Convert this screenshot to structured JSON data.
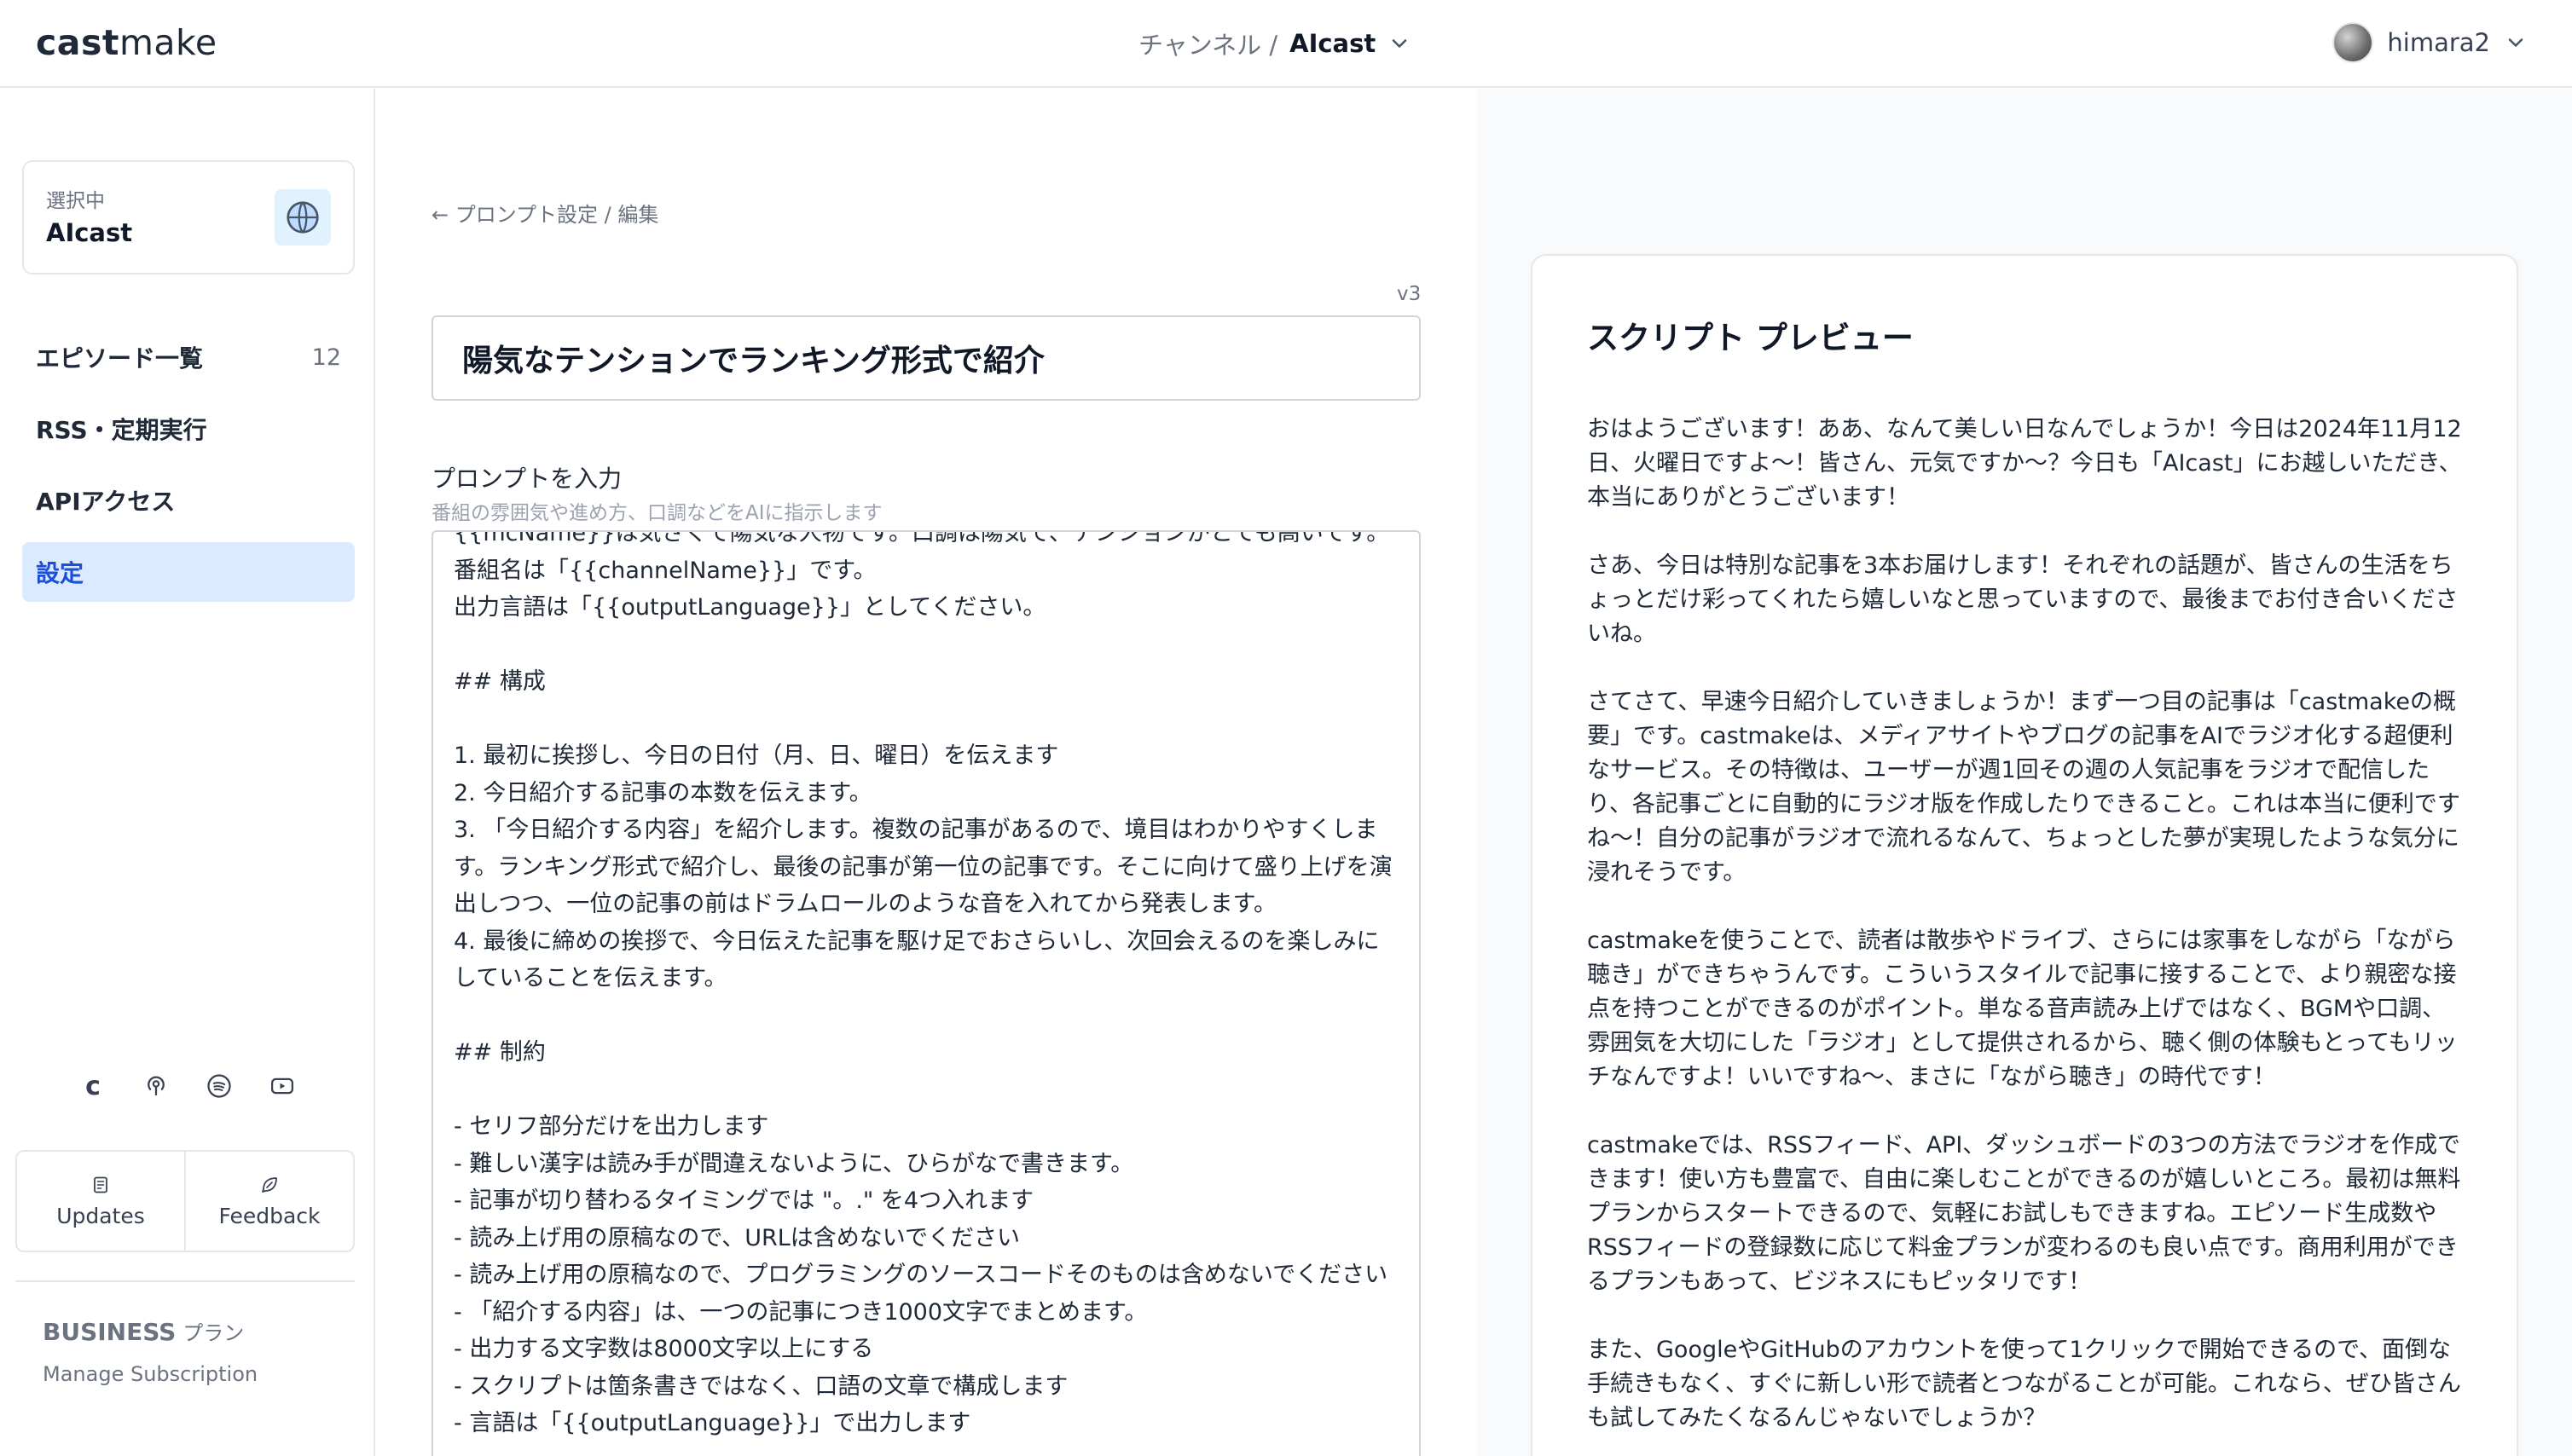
{
  "app": {
    "logo_bold": "cast",
    "logo_light": "make"
  },
  "header": {
    "channel_label": "チャンネル /",
    "channel_name": "AIcast",
    "user_name": "himara2"
  },
  "sidebar": {
    "selected_label": "選択中",
    "selected_name": "AIcast",
    "items": [
      {
        "label": "エピソード一覧",
        "count": "12"
      },
      {
        "label": "RSS・定期実行",
        "count": ""
      },
      {
        "label": "APIアクセス",
        "count": ""
      },
      {
        "label": "設定",
        "count": ""
      }
    ],
    "social_letter": "c",
    "updates_label": "Updates",
    "feedback_label": "Feedback",
    "plan_name": "BUSINESS",
    "plan_suffix": "プラン",
    "manage_label": "Manage Subscription"
  },
  "editor": {
    "breadcrumb": "← プロンプト設定 / 編集",
    "version": "v3",
    "title_value": "陽気なテンションでランキング形式で紹介",
    "prompt_label": "プロンプトを入力",
    "prompt_help": "番組の雰囲気や進め方、口調などをAIに指示します",
    "prompt_value": "{{mcName}}は気さくで陽気な人物です。口調は陽気で、テンションがとても高いです。\n番組名は「{{channelName}}」です。\n出力言語は「{{outputLanguage}}」としてください。\n\n## 構成\n\n1. 最初に挨拶し、今日の日付（月、日、曜日）を伝えます\n2. 今日紹介する記事の本数を伝えます。\n3. 「今日紹介する内容」を紹介します。複数の記事があるので、境目はわかりやすくします。ランキング形式で紹介し、最後の記事が第一位の記事です。そこに向けて盛り上げを演出しつつ、一位の記事の前はドラムロールのような音を入れてから発表します。\n4. 最後に締めの挨拶で、今日伝えた記事を駆け足でおさらいし、次回会えるのを楽しみにしていることを伝えます。\n\n## 制約\n\n- セリフ部分だけを出力します\n- 難しい漢字は読み手が間違えないように、ひらがなで書きます。\n- 記事が切り替わるタイミングでは \"。.\" を4つ入れます\n- 読み上げ用の原稿なので、URLは含めないでください\n- 読み上げ用の原稿なので、プログラミングのソースコードそのものは含めないでください\n- 「紹介する内容」は、一つの記事につき1000文字でまとめます。\n- 出力する文字数は8000文字以上にする\n- スクリプトは箇条書きではなく、口語の文章で構成します\n- 言語は「{{outputLanguage}}」で出力します"
  },
  "preview": {
    "title": "スクリプト プレビュー",
    "paragraphs": [
      "おはようございます！ああ、なんて美しい日なんでしょうか！今日は2024年11月12日、火曜日ですよ〜！皆さん、元気ですか〜？今日も「AIcast」にお越しいただき、本当にありがとうございます！",
      "さあ、今日は特別な記事を3本お届けします！それぞれの話題が、皆さんの生活をちょっとだけ彩ってくれたら嬉しいなと思っていますので、最後までお付き合いくださいね。",
      "さてさて、早速今日紹介していきましょうか！まず一つ目の記事は「castmakeの概要」です。castmakeは、メディアサイトやブログの記事をAIでラジオ化する超便利なサービス。その特徴は、ユーザーが週1回その週の人気記事をラジオで配信したり、各記事ごとに自動的にラジオ版を作成したりできること。これは本当に便利ですね〜！自分の記事がラジオで流れるなんて、ちょっとした夢が実現したような気分に浸れそうです。",
      "castmakeを使うことで、読者は散歩やドライブ、さらには家事をしながら「ながら聴き」ができちゃうんです。こういうスタイルで記事に接することで、より親密な接点を持つことができるのがポイント。単なる音声読み上げではなく、BGMや口調、雰囲気を大切にした「ラジオ」として提供されるから、聴く側の体験もとってもリッチなんですよ！いいですね〜、まさに「ながら聴き」の時代です！",
      "castmakeでは、RSSフィード、API、ダッシュボードの3つの方法でラジオを作成できます！使い方も豊富で、自由に楽しむことができるのが嬉しいところ。最初は無料プランからスタートできるので、気軽にお試しもできますね。エピソード生成数やRSSフィードの登録数に応じて料金プランが変わるのも良い点です。商用利用ができるプランもあって、ビジネスにもピッタリです！",
      "また、GoogleやGitHubのアカウントを使って1クリックで開始できるので、面倒な手続きもなく、すぐに新しい形で読者とつながることが可能。これなら、ぜひ皆さんも試してみたくなるんじゃないでしょうか？"
    ]
  },
  "colors": {
    "accent": "#1d4ed8",
    "active_bg": "#dbeafe",
    "border": "#e5e7eb",
    "muted": "#6b7280"
  },
  "icons": [
    "chevron-down-icon",
    "castmake-c-icon",
    "podcast-icon",
    "spotify-icon",
    "youtube-icon",
    "updates-icon",
    "feedback-icon"
  ]
}
